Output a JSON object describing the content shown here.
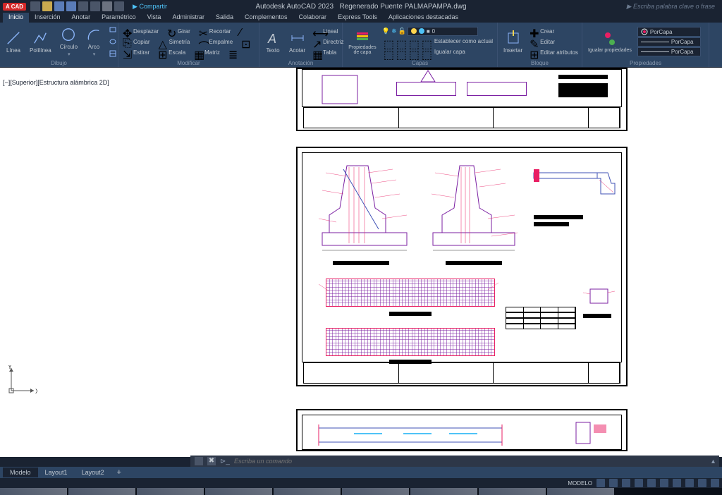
{
  "app": {
    "badge": "A CAD",
    "name": "Autodesk AutoCAD 2023",
    "document": "Regenerado Puente PALMAPAMPA.dwg",
    "share": "Compartir",
    "search_placeholder": "Escriba palabra clave o frase"
  },
  "menu": {
    "items": [
      "Inicio",
      "Inserción",
      "Anotar",
      "Paramétrico",
      "Vista",
      "Administrar",
      "Salida",
      "Complementos",
      "Colaborar",
      "Express Tools",
      "Aplicaciones destacadas"
    ],
    "active": 0
  },
  "ribbon": {
    "dibujo": {
      "title": "Dibujo",
      "linea": "Línea",
      "polilinea": "Polilínea",
      "circulo": "Círculo",
      "arco": "Arco"
    },
    "modificar": {
      "title": "Modificar",
      "desplazar": "Desplazar",
      "girar": "Girar",
      "recortar": "Recortar",
      "copiar": "Copiar",
      "simetria": "Simetría",
      "empalme": "Empalme",
      "estirar": "Estirar",
      "escala": "Escala",
      "matriz": "Matriz"
    },
    "anotacion": {
      "title": "Anotación",
      "texto": "Texto",
      "acotar": "Acotar",
      "lineal": "Lineal",
      "directriz": "Directriz",
      "tabla": "Tabla"
    },
    "capas": {
      "title": "Capas",
      "propiedades": "Propiedades de capa",
      "actual": "Establecer como actual",
      "igualar": "Igualar capa",
      "current_layer": "0"
    },
    "bloque": {
      "title": "Bloque",
      "insertar": "Insertar",
      "crear": "Crear",
      "editar": "Editar",
      "atributos": "Editar atributos"
    },
    "propiedades": {
      "title": "Propiedades",
      "igualar": "Igualar propiedades",
      "porcapa": "PorCapa"
    }
  },
  "viewport": {
    "label": "[−][Superior][Estructura alámbrica 2D]"
  },
  "command": {
    "placeholder": "Escriba un comando"
  },
  "layout_tabs": {
    "tabs": [
      "Modelo",
      "Layout1",
      "Layout2"
    ],
    "active": 0
  },
  "status": {
    "model": "MODELO"
  },
  "ucs": {
    "x": "X",
    "y": "Y"
  }
}
